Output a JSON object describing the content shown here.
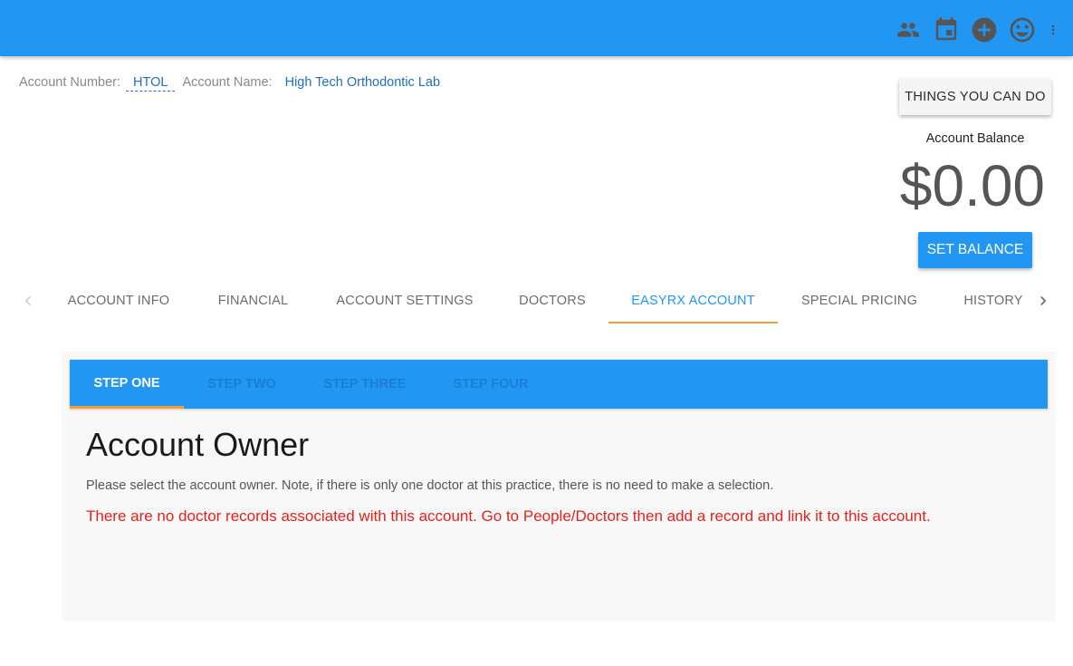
{
  "topbar": {
    "icons": [
      "people-icon",
      "calendar-icon",
      "add-circle-icon",
      "smiley-icon",
      "more-vert-icon"
    ],
    "color": "#2196f3"
  },
  "account": {
    "number_label": "Account Number:",
    "number": "HTOL",
    "name_label": "Account Name:",
    "name": "High Tech Orthodontic Lab"
  },
  "actions": {
    "things_label": "THINGS YOU CAN DO",
    "balance_label": "Account Balance",
    "balance_value": "$0.00",
    "set_balance_label": "SET BALANCE"
  },
  "tabs": {
    "items": [
      {
        "label": "ACCOUNT INFO"
      },
      {
        "label": "FINANCIAL"
      },
      {
        "label": "ACCOUNT SETTINGS"
      },
      {
        "label": "DOCTORS"
      },
      {
        "label": "EASYRX ACCOUNT"
      },
      {
        "label": "SPECIAL PRICING"
      },
      {
        "label": "HISTORY"
      }
    ],
    "active": "EASYRX ACCOUNT"
  },
  "steps": {
    "items": [
      {
        "label": "STEP ONE"
      },
      {
        "label": "STEP TWO"
      },
      {
        "label": "STEP THREE"
      },
      {
        "label": "STEP FOUR"
      }
    ],
    "active": "STEP ONE"
  },
  "content": {
    "title": "Account Owner",
    "description": "Please select the account owner. Note, if there is only one doctor at this practice, there is no need to make a selection.",
    "warning": "There are no doctor records associated with this account. Go to People/Doctors then add a record and link it to this account."
  },
  "colors": {
    "primary": "#2196f3",
    "accent": "#f0a030",
    "link": "#1e6fc2",
    "warning": "#e8201a"
  }
}
